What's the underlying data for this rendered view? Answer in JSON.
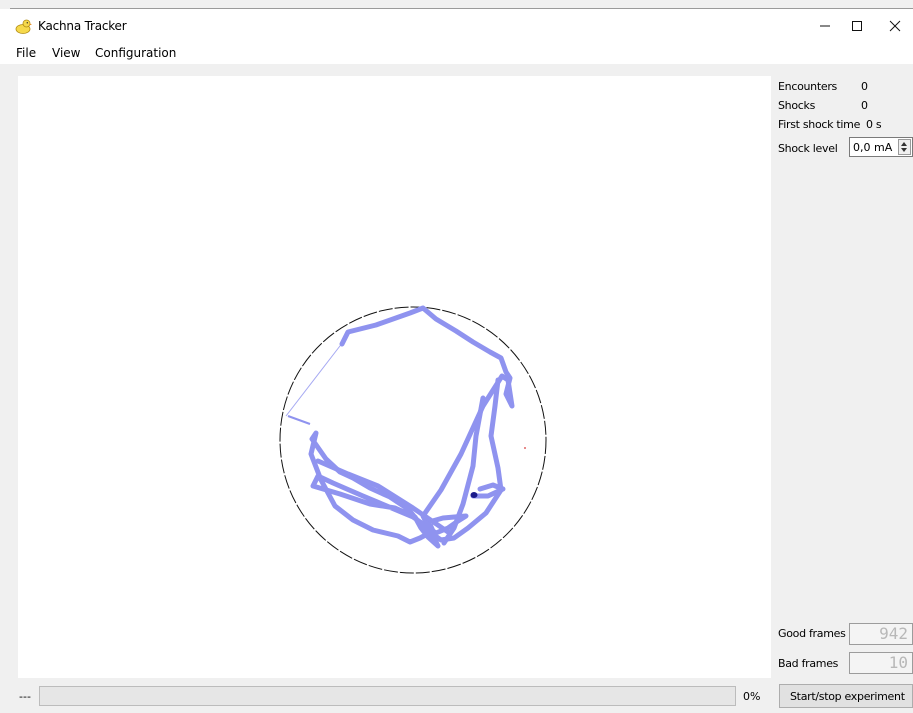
{
  "window": {
    "title": "Kachna Tracker",
    "icon": "duck-icon",
    "controls": [
      "minimize-icon",
      "maximize-icon",
      "close-icon"
    ]
  },
  "menu": {
    "file": "File",
    "view": "View",
    "configuration": "Configuration"
  },
  "side_panel": {
    "encounters_label": "Encounters",
    "encounters_value": "0",
    "shocks_label": "Shocks",
    "shocks_value": "0",
    "first_shock_label": "First shock time",
    "first_shock_value": "0 s",
    "shock_level_label": "Shock level",
    "shock_level_value": "0,0 mA",
    "good_frames_label": "Good frames",
    "good_frames_value": "942",
    "bad_frames_label": "Bad frames",
    "bad_frames_value": "10"
  },
  "status_bar": {
    "status_text": "---",
    "progress_percent": 0,
    "progress_text": "0%",
    "start_button_label": "Start/stop experiment"
  },
  "colors": {
    "track": "#8f93ef",
    "animal": "#1a1a8a",
    "arena": "#111111",
    "progress_fill": "#06b025"
  }
}
